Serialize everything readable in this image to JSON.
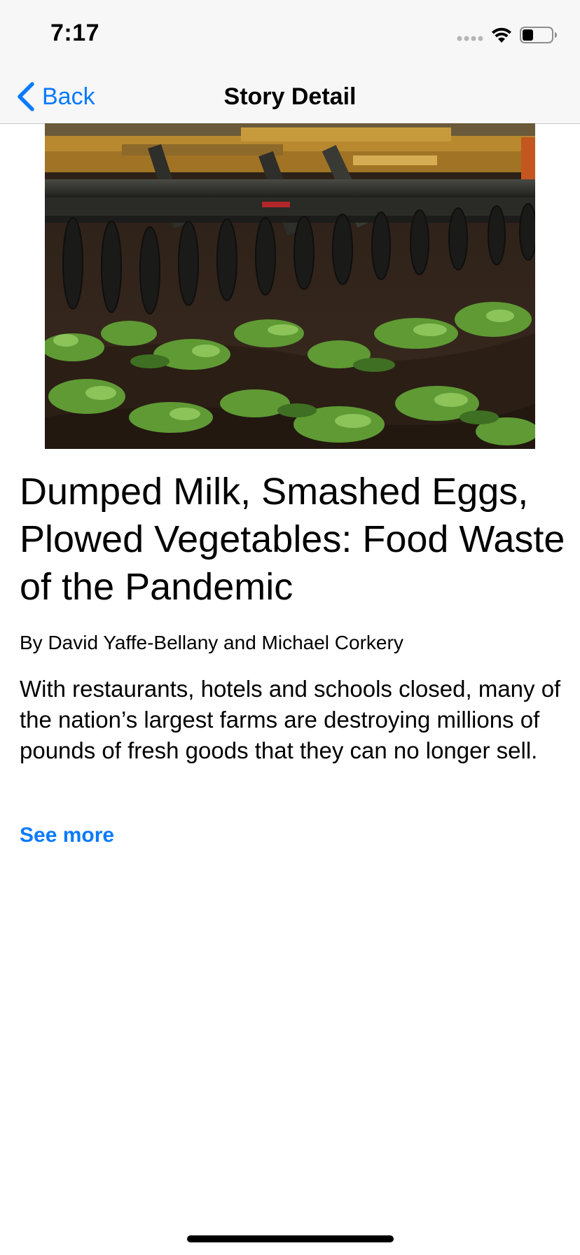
{
  "status_bar": {
    "time": "7:17"
  },
  "nav": {
    "back_label": "Back",
    "title": "Story Detail"
  },
  "story": {
    "image_alt": "Tractor disc harrow plowing rows of green vegetable plants into dark soil",
    "headline": "Dumped Milk, Smashed Eggs, Plowed Vegetables: Food Waste of the Pandemic",
    "byline": "By David Yaffe-Bellany and Michael Corkery",
    "summary": "With restaurants, hotels and schools closed, many of the nation’s largest farms are destroying millions of pounds of fresh goods that they can no longer sell.",
    "see_more_label": "See more"
  },
  "colors": {
    "accent": "#0a7aff",
    "bar_background": "#f7f7f7",
    "separator": "#c8c7cc"
  },
  "icons": {
    "back": "chevron-left-icon",
    "wifi": "wifi-icon",
    "battery": "battery-icon",
    "signal": "cellular-signal-icon"
  }
}
